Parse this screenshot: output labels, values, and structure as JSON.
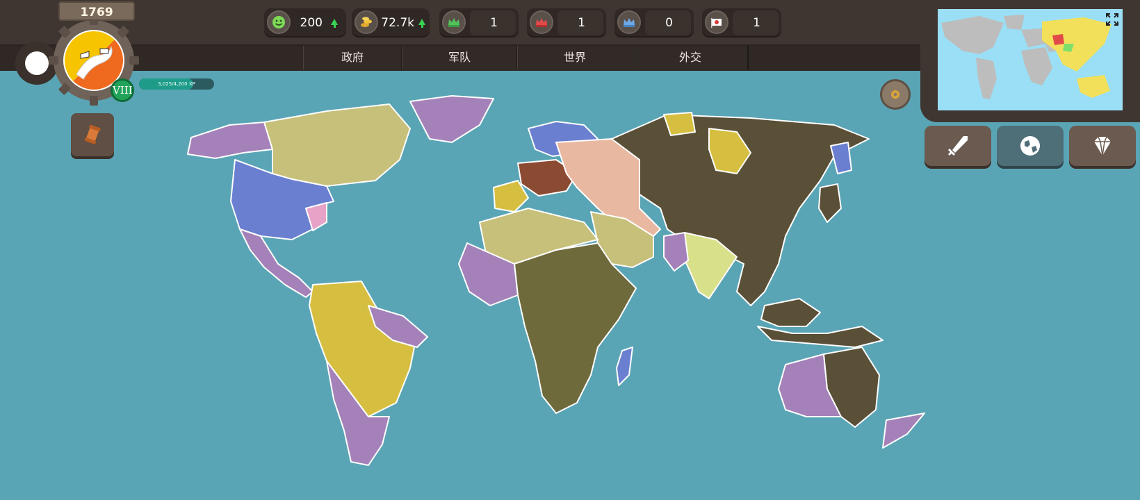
{
  "player": {
    "year": "1769",
    "level": "VIII",
    "xp_text": "3,025/4,200 XP",
    "xp_progress": 0.72
  },
  "resources": [
    {
      "id": "happiness",
      "icon": "smiley-icon",
      "value": "200",
      "trend": "up"
    },
    {
      "id": "gold",
      "icon": "coins-icon",
      "value": "72.7k",
      "trend": "up"
    },
    {
      "id": "crown-green",
      "icon": "crown-green-icon",
      "value": "1"
    },
    {
      "id": "crown-red",
      "icon": "crown-red-icon",
      "value": "1"
    },
    {
      "id": "crown-blue",
      "icon": "crown-blue-icon",
      "value": "0"
    },
    {
      "id": "flag",
      "icon": "flag-icon",
      "value": "1"
    }
  ],
  "tabs": [
    {
      "id": "government",
      "label": "政府"
    },
    {
      "id": "army",
      "label": "军队"
    },
    {
      "id": "world",
      "label": "世界"
    },
    {
      "id": "diplomacy",
      "label": "外交"
    }
  ],
  "actions": [
    {
      "id": "war",
      "icon": "sword-icon"
    },
    {
      "id": "world",
      "icon": "globe-icon"
    },
    {
      "id": "premium",
      "icon": "diamond-icon"
    }
  ],
  "colors": {
    "ocean": "#5aa5b5",
    "player_territory": "#5a5037",
    "purple_empire": "#a482b9",
    "yellow_empire": "#d6bf40",
    "blue_empire": "#6a7fd0",
    "khaki_empire": "#c7c07a",
    "africa_empire": "#6e6a3c",
    "peach_empire": "#e9b8a0"
  }
}
